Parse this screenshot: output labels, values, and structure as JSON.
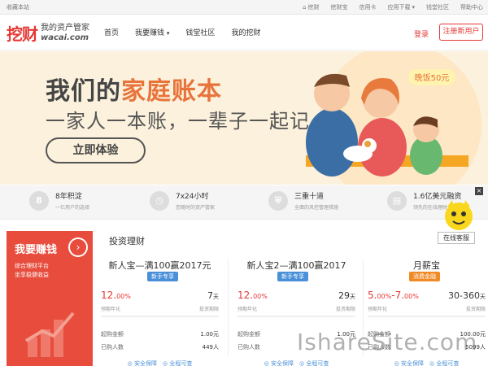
{
  "topbar": {
    "favorite": "收藏本站",
    "links": [
      {
        "icon": "home-icon",
        "label": "挖财"
      },
      {
        "icon": "",
        "label": "挖财宝"
      },
      {
        "icon": "",
        "label": "信用卡"
      },
      {
        "icon": "",
        "label": "应用下载"
      },
      {
        "icon": "",
        "label": "钱堂社区"
      },
      {
        "icon": "",
        "label": "帮助中心"
      }
    ]
  },
  "header": {
    "logo_mark": "挖财",
    "logo_tagline": "我的资产管家",
    "logo_domain": "wacai.com",
    "nav": [
      "首页",
      "我要赚钱",
      "钱堂社区",
      "我的挖财"
    ],
    "login": "登录",
    "register": "注册新用户"
  },
  "banner": {
    "title_pre": "我们的",
    "title_hl": "家庭账本",
    "subtitle": "一家人一本账，一辈子一起记",
    "cta": "立即体验",
    "bubble": "晚饭50元",
    "colors": {
      "accent": "#e8743b",
      "bg": "#fbf1dc"
    }
  },
  "features": [
    {
      "icon": "8",
      "title": "8年积淀",
      "desc": "一亿用户的选择"
    },
    {
      "icon": "◷",
      "title": "7x24小时",
      "desc": "您随时的资产管家"
    },
    {
      "icon": "⛨",
      "title": "三重十道",
      "desc": "全面的风控管理措施"
    },
    {
      "icon": "▤",
      "title": "1.6亿美元融资",
      "desc": "领先的在线理财"
    }
  ],
  "widget": {
    "chat": "在线客服",
    "close": "×"
  },
  "promo": {
    "title": "我要赚钱",
    "line1": "综合理财平台",
    "line2": "坐享稳健收益",
    "arrow": "›"
  },
  "section_title": "投资理财",
  "products": [
    {
      "name": "新人宝—满100赢2017元",
      "badge": "新手专享",
      "badge_color": "#4a90d9",
      "rate": "12.",
      "rate_small": "00%",
      "rate_label": "预期年化",
      "term": "7",
      "term_unit": "天",
      "term_label": "投资期限",
      "min_label": "起购金额",
      "min_value": "1.00元",
      "buyers_label": "已购人数",
      "buyers_value": "449人",
      "footer": "◎ 安全保障　◎ 全程可查"
    },
    {
      "name": "新人宝2—满100赢2017",
      "badge": "新手专享",
      "badge_color": "#4a90d9",
      "rate": "12.",
      "rate_small": "00%",
      "rate_label": "预期年化",
      "term": "29",
      "term_unit": "天",
      "term_label": "投资期限",
      "min_label": "起购金额",
      "min_value": "1.00元",
      "buyers_label": "已购人数",
      "buyers_value": "",
      "footer": "◎ 安全保障　◎ 全程可查"
    },
    {
      "name": "月薪宝",
      "badge": "消费金融",
      "badge_color": "#f08a24",
      "rate": "5.",
      "rate_small": "00%",
      "rate_mid": "-7.",
      "rate_small2": "00%",
      "rate_label": "预期年化",
      "term": "30-360",
      "term_unit": "天",
      "term_label": "投资期限",
      "min_label": "起购金额",
      "min_value": "100.00元",
      "buyers_label": "已购人数",
      "buyers_value": "5099人",
      "footer": "◎ 安全保障　◎ 全程可查"
    }
  ],
  "watermark": "IshareSite.com"
}
